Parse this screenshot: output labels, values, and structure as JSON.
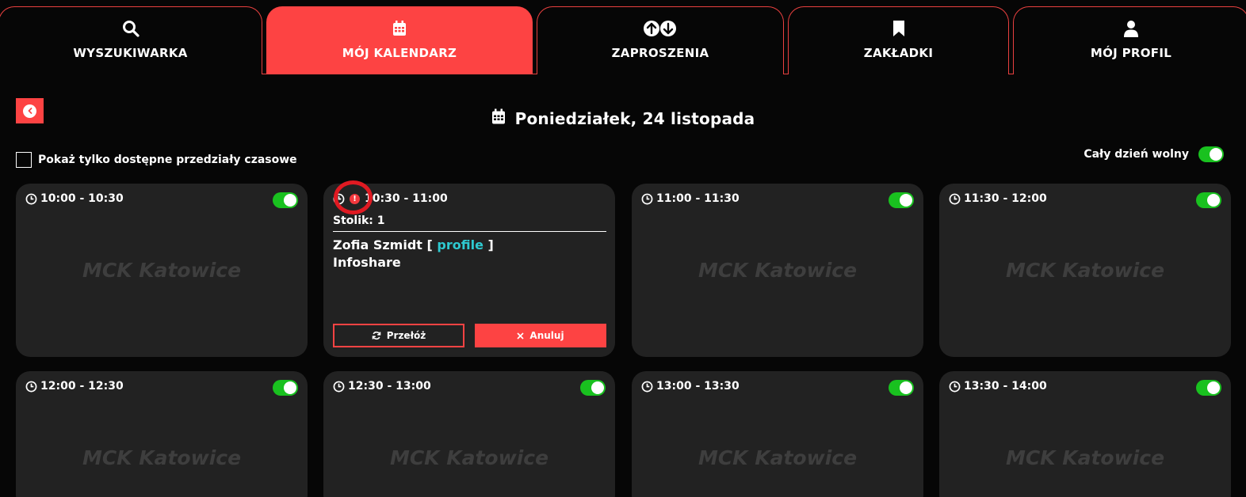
{
  "tabs": [
    {
      "label": "WYSZUKIWARKA",
      "icon": "search-icon"
    },
    {
      "label": "MÓJ KALENDARZ",
      "icon": "calendar-icon",
      "active": true
    },
    {
      "label": "ZAPROSZENIA",
      "icon": "up-down-arrows-icon"
    },
    {
      "label": "ZAKŁADKI",
      "icon": "bookmark-icon"
    },
    {
      "label": "MÓJ PROFIL",
      "icon": "user-icon"
    }
  ],
  "header": {
    "date": "Poniedziałek, 24 listopada",
    "filter_label": "Pokaż tylko dostępne przedziały czasowe",
    "day_off_label": "Cały dzień wolny"
  },
  "slots": [
    {
      "time": "10:00 - 10:30",
      "venue": "MCK Katowice"
    },
    {
      "time": "10:30 - 11:00",
      "table_label": "Stolik:",
      "table_no": "1",
      "person": "Zofia Szmidt",
      "bracket_open": "[",
      "profile_link": "profile",
      "bracket_close": "]",
      "company": "Infoshare",
      "move_label": "Przełóż",
      "cancel_label": "Anuluj"
    },
    {
      "time": "11:00 - 11:30",
      "venue": "MCK Katowice"
    },
    {
      "time": "11:30 - 12:00",
      "venue": "MCK Katowice"
    },
    {
      "time": "12:00 - 12:30",
      "venue": "MCK Katowice"
    },
    {
      "time": "12:30 - 13:00",
      "venue": "MCK Katowice"
    },
    {
      "time": "13:00 - 13:30",
      "venue": "MCK Katowice"
    },
    {
      "time": "13:30 - 14:00",
      "venue": "MCK Katowice"
    }
  ],
  "colors": {
    "accent": "#fd4343",
    "toggle_on": "#19c11f",
    "link": "#2ec9d0",
    "card": "#222222"
  }
}
